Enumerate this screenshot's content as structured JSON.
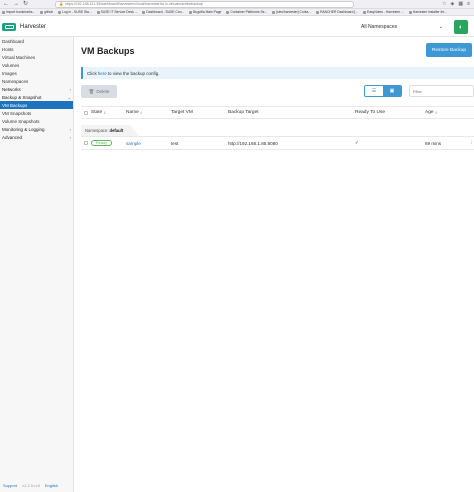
{
  "browser": {
    "url": "https://192.168.121.35/dashboard/harvester/c/local/harvesterhci.io.virtualmachinebackup",
    "nav": {
      "back": "←",
      "forward": "→",
      "reload": "↻"
    },
    "bookmarks": [
      "Import bookmarks...",
      "github",
      "Log in - SUSE Sta...",
      "SUSE IT Service Desk ...",
      "Dashboard - SUSE Con...",
      "Bugzilla Main Page",
      "Container Platforms Se...",
      "[sles/harvester] Conta...",
      "RANCHER Dashboard [...",
      "EasyNotes - Harvester ...",
      "Harvester Installer Int..."
    ]
  },
  "header": {
    "brand": "Harvester",
    "namespace_select": "All Namespaces",
    "colors": {
      "logo": "#1aa084",
      "user": "#2aa55e"
    }
  },
  "sidebar": {
    "items": [
      {
        "label": "Dashboard",
        "type": "item"
      },
      {
        "label": "Hosts",
        "type": "item"
      },
      {
        "label": "Virtual Machines",
        "type": "item"
      },
      {
        "label": "Volumes",
        "type": "item"
      },
      {
        "label": "Images",
        "type": "item"
      },
      {
        "label": "Namespaces",
        "type": "item"
      },
      {
        "label": "Networks",
        "type": "group",
        "chevron": "›"
      },
      {
        "label": "Backup & Snapshot",
        "type": "group",
        "chevron": "⌄"
      },
      {
        "label": "VM Backups",
        "type": "active"
      },
      {
        "label": "VM Snapshots",
        "type": "item"
      },
      {
        "label": "Volume Snapshots",
        "type": "item"
      },
      {
        "label": "Monitoring & Logging",
        "type": "group",
        "chevron": "›"
      },
      {
        "label": "Advanced",
        "type": "group",
        "chevron": "›"
      }
    ],
    "footer": {
      "support": "Support",
      "version": "v1.2.0-rc3",
      "language": "English"
    }
  },
  "main": {
    "title": "VM Backups",
    "restore_button": "Restore Backup",
    "banner": {
      "prefix": "Click",
      "link": "here",
      "suffix": "to view the backup config."
    },
    "delete_button": "Delete",
    "delete_icon": "🗑",
    "view_toggle": {
      "list_icon": "☰",
      "folder_icon": "▣"
    },
    "filter_placeholder": "Filter",
    "table": {
      "columns": [
        "State",
        "Name",
        "Target VM",
        "Backup Target",
        "Ready To Use",
        "Age"
      ],
      "namespace_label": "Namespace:",
      "namespace_value": "default",
      "rows": [
        {
          "state": "Ready",
          "name": "sample",
          "target_vm": "test",
          "backup_target": "http://192.168.1.85:8080",
          "ready": "✓",
          "age": "59 mins",
          "menu": "⋮"
        }
      ]
    }
  },
  "colors": {
    "primary": "#3d98d3",
    "active_nav": "#1e73be",
    "ready": "#5fb760"
  }
}
